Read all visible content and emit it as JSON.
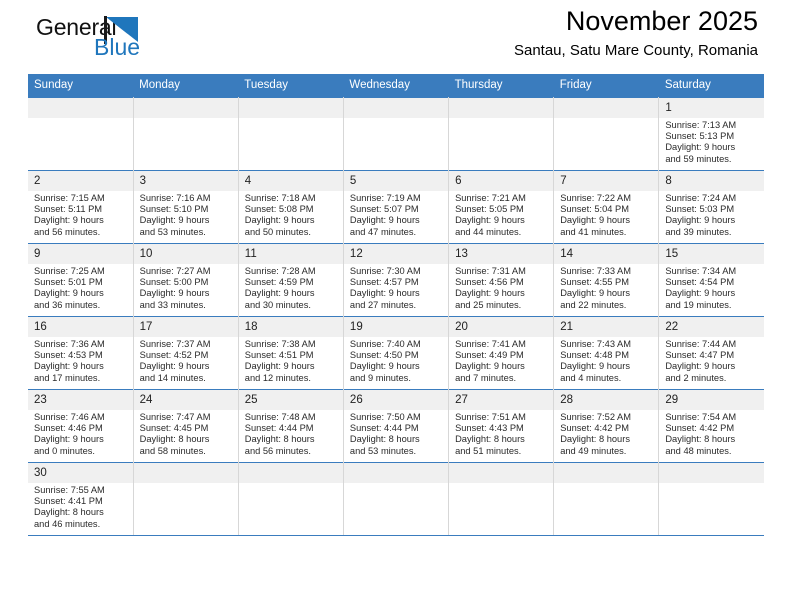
{
  "brand": {
    "name_top": "General",
    "name_bottom": "Blue",
    "flag_icon": "blue-flag-triangle-icon",
    "accent_color": "#1f76bc"
  },
  "header": {
    "month_title": "November 2025",
    "location": "Santau, Satu Mare County, Romania"
  },
  "calendar": {
    "header_color": "#3a7cbe",
    "daynum_background": "#f0f0f0",
    "weekday_headers": [
      "Sunday",
      "Monday",
      "Tuesday",
      "Wednesday",
      "Thursday",
      "Friday",
      "Saturday"
    ],
    "labels": {
      "sunrise": "Sunrise:",
      "sunset": "Sunset:",
      "daylight": "Daylight:"
    },
    "weeks": [
      [
        {
          "day": ""
        },
        {
          "day": ""
        },
        {
          "day": ""
        },
        {
          "day": ""
        },
        {
          "day": ""
        },
        {
          "day": ""
        },
        {
          "day": "1",
          "sunrise": "Sunrise: 7:13 AM",
          "sunset": "Sunset: 5:13 PM",
          "daylight_line1": "Daylight: 9 hours",
          "daylight_line2": "and 59 minutes."
        }
      ],
      [
        {
          "day": "2",
          "sunrise": "Sunrise: 7:15 AM",
          "sunset": "Sunset: 5:11 PM",
          "daylight_line1": "Daylight: 9 hours",
          "daylight_line2": "and 56 minutes."
        },
        {
          "day": "3",
          "sunrise": "Sunrise: 7:16 AM",
          "sunset": "Sunset: 5:10 PM",
          "daylight_line1": "Daylight: 9 hours",
          "daylight_line2": "and 53 minutes."
        },
        {
          "day": "4",
          "sunrise": "Sunrise: 7:18 AM",
          "sunset": "Sunset: 5:08 PM",
          "daylight_line1": "Daylight: 9 hours",
          "daylight_line2": "and 50 minutes."
        },
        {
          "day": "5",
          "sunrise": "Sunrise: 7:19 AM",
          "sunset": "Sunset: 5:07 PM",
          "daylight_line1": "Daylight: 9 hours",
          "daylight_line2": "and 47 minutes."
        },
        {
          "day": "6",
          "sunrise": "Sunrise: 7:21 AM",
          "sunset": "Sunset: 5:05 PM",
          "daylight_line1": "Daylight: 9 hours",
          "daylight_line2": "and 44 minutes."
        },
        {
          "day": "7",
          "sunrise": "Sunrise: 7:22 AM",
          "sunset": "Sunset: 5:04 PM",
          "daylight_line1": "Daylight: 9 hours",
          "daylight_line2": "and 41 minutes."
        },
        {
          "day": "8",
          "sunrise": "Sunrise: 7:24 AM",
          "sunset": "Sunset: 5:03 PM",
          "daylight_line1": "Daylight: 9 hours",
          "daylight_line2": "and 39 minutes."
        }
      ],
      [
        {
          "day": "9",
          "sunrise": "Sunrise: 7:25 AM",
          "sunset": "Sunset: 5:01 PM",
          "daylight_line1": "Daylight: 9 hours",
          "daylight_line2": "and 36 minutes."
        },
        {
          "day": "10",
          "sunrise": "Sunrise: 7:27 AM",
          "sunset": "Sunset: 5:00 PM",
          "daylight_line1": "Daylight: 9 hours",
          "daylight_line2": "and 33 minutes."
        },
        {
          "day": "11",
          "sunrise": "Sunrise: 7:28 AM",
          "sunset": "Sunset: 4:59 PM",
          "daylight_line1": "Daylight: 9 hours",
          "daylight_line2": "and 30 minutes."
        },
        {
          "day": "12",
          "sunrise": "Sunrise: 7:30 AM",
          "sunset": "Sunset: 4:57 PM",
          "daylight_line1": "Daylight: 9 hours",
          "daylight_line2": "and 27 minutes."
        },
        {
          "day": "13",
          "sunrise": "Sunrise: 7:31 AM",
          "sunset": "Sunset: 4:56 PM",
          "daylight_line1": "Daylight: 9 hours",
          "daylight_line2": "and 25 minutes."
        },
        {
          "day": "14",
          "sunrise": "Sunrise: 7:33 AM",
          "sunset": "Sunset: 4:55 PM",
          "daylight_line1": "Daylight: 9 hours",
          "daylight_line2": "and 22 minutes."
        },
        {
          "day": "15",
          "sunrise": "Sunrise: 7:34 AM",
          "sunset": "Sunset: 4:54 PM",
          "daylight_line1": "Daylight: 9 hours",
          "daylight_line2": "and 19 minutes."
        }
      ],
      [
        {
          "day": "16",
          "sunrise": "Sunrise: 7:36 AM",
          "sunset": "Sunset: 4:53 PM",
          "daylight_line1": "Daylight: 9 hours",
          "daylight_line2": "and 17 minutes."
        },
        {
          "day": "17",
          "sunrise": "Sunrise: 7:37 AM",
          "sunset": "Sunset: 4:52 PM",
          "daylight_line1": "Daylight: 9 hours",
          "daylight_line2": "and 14 minutes."
        },
        {
          "day": "18",
          "sunrise": "Sunrise: 7:38 AM",
          "sunset": "Sunset: 4:51 PM",
          "daylight_line1": "Daylight: 9 hours",
          "daylight_line2": "and 12 minutes."
        },
        {
          "day": "19",
          "sunrise": "Sunrise: 7:40 AM",
          "sunset": "Sunset: 4:50 PM",
          "daylight_line1": "Daylight: 9 hours",
          "daylight_line2": "and 9 minutes."
        },
        {
          "day": "20",
          "sunrise": "Sunrise: 7:41 AM",
          "sunset": "Sunset: 4:49 PM",
          "daylight_line1": "Daylight: 9 hours",
          "daylight_line2": "and 7 minutes."
        },
        {
          "day": "21",
          "sunrise": "Sunrise: 7:43 AM",
          "sunset": "Sunset: 4:48 PM",
          "daylight_line1": "Daylight: 9 hours",
          "daylight_line2": "and 4 minutes."
        },
        {
          "day": "22",
          "sunrise": "Sunrise: 7:44 AM",
          "sunset": "Sunset: 4:47 PM",
          "daylight_line1": "Daylight: 9 hours",
          "daylight_line2": "and 2 minutes."
        }
      ],
      [
        {
          "day": "23",
          "sunrise": "Sunrise: 7:46 AM",
          "sunset": "Sunset: 4:46 PM",
          "daylight_line1": "Daylight: 9 hours",
          "daylight_line2": "and 0 minutes."
        },
        {
          "day": "24",
          "sunrise": "Sunrise: 7:47 AM",
          "sunset": "Sunset: 4:45 PM",
          "daylight_line1": "Daylight: 8 hours",
          "daylight_line2": "and 58 minutes."
        },
        {
          "day": "25",
          "sunrise": "Sunrise: 7:48 AM",
          "sunset": "Sunset: 4:44 PM",
          "daylight_line1": "Daylight: 8 hours",
          "daylight_line2": "and 56 minutes."
        },
        {
          "day": "26",
          "sunrise": "Sunrise: 7:50 AM",
          "sunset": "Sunset: 4:44 PM",
          "daylight_line1": "Daylight: 8 hours",
          "daylight_line2": "and 53 minutes."
        },
        {
          "day": "27",
          "sunrise": "Sunrise: 7:51 AM",
          "sunset": "Sunset: 4:43 PM",
          "daylight_line1": "Daylight: 8 hours",
          "daylight_line2": "and 51 minutes."
        },
        {
          "day": "28",
          "sunrise": "Sunrise: 7:52 AM",
          "sunset": "Sunset: 4:42 PM",
          "daylight_line1": "Daylight: 8 hours",
          "daylight_line2": "and 49 minutes."
        },
        {
          "day": "29",
          "sunrise": "Sunrise: 7:54 AM",
          "sunset": "Sunset: 4:42 PM",
          "daylight_line1": "Daylight: 8 hours",
          "daylight_line2": "and 48 minutes."
        }
      ],
      [
        {
          "day": "30",
          "sunrise": "Sunrise: 7:55 AM",
          "sunset": "Sunset: 4:41 PM",
          "daylight_line1": "Daylight: 8 hours",
          "daylight_line2": "and 46 minutes."
        },
        {
          "day": ""
        },
        {
          "day": ""
        },
        {
          "day": ""
        },
        {
          "day": ""
        },
        {
          "day": ""
        },
        {
          "day": ""
        }
      ]
    ]
  }
}
